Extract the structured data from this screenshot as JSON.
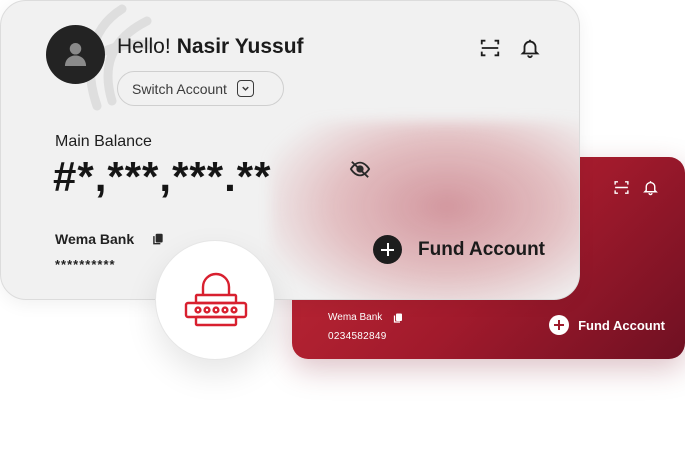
{
  "header": {
    "greeting": "Hello!",
    "user_name": "Nasir Yussuf",
    "switch_account_label": "Switch Account"
  },
  "balance": {
    "label": "Main Balance",
    "masked_value": "#*,***,***.**"
  },
  "account": {
    "bank_name": "Wema Bank",
    "masked_number": "**********"
  },
  "actions": {
    "fund_account_label": "Fund Account"
  },
  "secondary_card": {
    "bank_name": "Wema Bank",
    "account_number": "0234582849",
    "fund_account_label": "Fund Account"
  },
  "icons": {
    "avatar": "user-icon",
    "scan": "scan-icon",
    "notification": "bell-icon",
    "visibility": "eye-off-icon",
    "copy": "copy-icon",
    "switch": "chevron-down-icon",
    "fund": "plus-circle-icon",
    "security": "lock-icon"
  },
  "colors": {
    "card_background": "#f1f1f1",
    "brand_red": "#a11a2c",
    "dark": "#1d1d1d",
    "lock_red": "#d8202f"
  }
}
